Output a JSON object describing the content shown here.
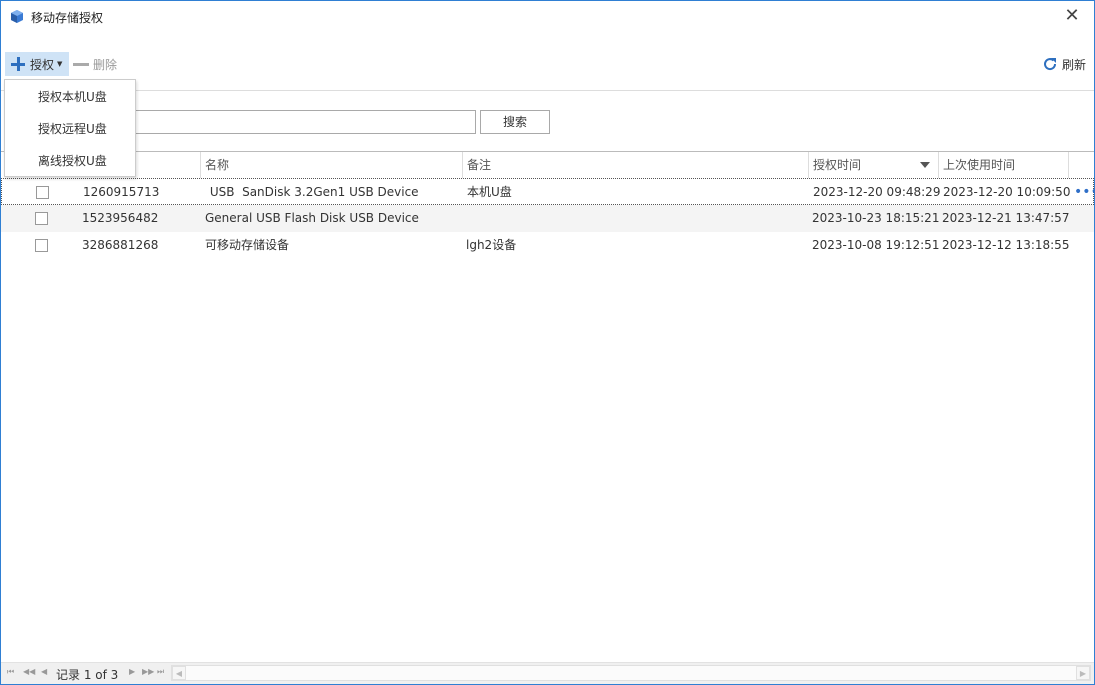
{
  "window": {
    "title": "移动存储授权",
    "close_glyph": "✕"
  },
  "toolbar": {
    "authorize_label": "授权",
    "delete_label": "删除",
    "refresh_label": "刷新"
  },
  "authorize_menu": {
    "items": [
      {
        "label": "授权本机U盘"
      },
      {
        "label": "授权远程U盘"
      },
      {
        "label": "离线授权U盘"
      }
    ]
  },
  "search": {
    "value": "",
    "button_label": "搜索"
  },
  "table": {
    "columns": [
      "名称",
      "备注",
      "授权时间",
      "上次使用时间"
    ],
    "sorted_column": "授权时间",
    "rows": [
      {
        "id": "1260915713",
        "name": " USB  SanDisk 3.2Gen1 USB Device",
        "note": "本机U盘",
        "auth_time": "2023-12-20 09:48:29",
        "last_used": "2023-12-20 10:09:50"
      },
      {
        "id": "1523956482",
        "name": "General USB Flash Disk USB Device",
        "note": "",
        "auth_time": "2023-10-23 18:15:21",
        "last_used": "2023-12-21 13:47:57"
      },
      {
        "id": "3286881268",
        "name": "可移动存储设备",
        "note": "lgh2设备",
        "auth_time": "2023-10-08 19:12:51",
        "last_used": "2023-12-12 13:18:55"
      }
    ],
    "row_more_glyph": "•••"
  },
  "pager": {
    "record_text": "记录 1 of 3"
  },
  "colors": {
    "accent": "#2f7fd3",
    "toolbar_active": "#cfe3f6",
    "icon_blue": "#2d6fbf"
  },
  "icons": [
    "app-icon",
    "close-icon",
    "plus-icon",
    "minus-icon",
    "refresh-icon",
    "more-icon"
  ]
}
